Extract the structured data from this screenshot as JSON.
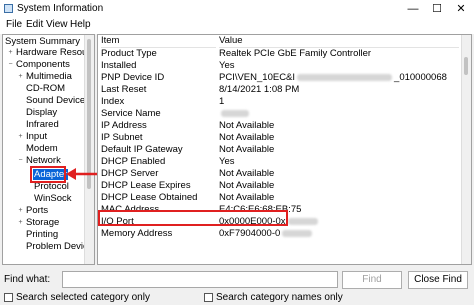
{
  "window": {
    "title": "System Information",
    "minimize": "—",
    "maximize": "☐",
    "close": "✕"
  },
  "menu": [
    "File",
    "Edit",
    "View",
    "Help"
  ],
  "tree": [
    {
      "label": "System Summary",
      "expander": ""
    },
    {
      "label": "Hardware Resource",
      "expander": "+"
    },
    {
      "label": "Components",
      "expander": "−"
    },
    {
      "label": "Multimedia",
      "expander": "+"
    },
    {
      "label": "CD-ROM",
      "expander": ""
    },
    {
      "label": "Sound Device",
      "expander": ""
    },
    {
      "label": "Display",
      "expander": ""
    },
    {
      "label": "Infrared",
      "expander": ""
    },
    {
      "label": "Input",
      "expander": "+"
    },
    {
      "label": "Modem",
      "expander": ""
    },
    {
      "label": "Network",
      "expander": "−"
    },
    {
      "label": "Adapter",
      "expander": ""
    },
    {
      "label": "Protocol",
      "expander": ""
    },
    {
      "label": "WinSock",
      "expander": ""
    },
    {
      "label": "Ports",
      "expander": "+"
    },
    {
      "label": "Storage",
      "expander": "+"
    },
    {
      "label": "Printing",
      "expander": ""
    },
    {
      "label": "Problem Devices",
      "expander": ""
    }
  ],
  "list": {
    "col_item": "Item",
    "col_value": "Value",
    "rows": [
      {
        "item": "Product Type",
        "value": "Realtek PCIe GbE Family Controller"
      },
      {
        "item": "Installed",
        "value": "Yes"
      },
      {
        "item": "PNP Device ID",
        "value": "PCI\\VEN_10EC&I",
        "value2": "_010000068"
      },
      {
        "item": "Last Reset",
        "value": "8/14/2021 1:08 PM"
      },
      {
        "item": "Index",
        "value": "1"
      },
      {
        "item": "Service Name",
        "value": ""
      },
      {
        "item": "IP Address",
        "value": "Not Available"
      },
      {
        "item": "IP Subnet",
        "value": "Not Available"
      },
      {
        "item": "Default IP Gateway",
        "value": "Not Available"
      },
      {
        "item": "DHCP Enabled",
        "value": "Yes"
      },
      {
        "item": "DHCP Server",
        "value": "Not Available"
      },
      {
        "item": "DHCP Lease Expires",
        "value": "Not Available"
      },
      {
        "item": "DHCP Lease Obtained",
        "value": "Not Available"
      },
      {
        "item": "MAC Address",
        "value": "E4:C6:E6:68:EB:75"
      },
      {
        "item": "I/O Port",
        "value": "0x0000E000-0x"
      },
      {
        "item": "Memory Address",
        "value": "0xF7904000-0"
      },
      {
        "item": "",
        "value": ""
      }
    ]
  },
  "find": {
    "label": "Find what:",
    "value": "",
    "find_button": "Find",
    "close_button": "Close Find",
    "search_selected": "Search selected category only",
    "search_names": "Search category names only"
  },
  "colors": {
    "highlight": "#e02020",
    "selection": "#0a64d8"
  }
}
